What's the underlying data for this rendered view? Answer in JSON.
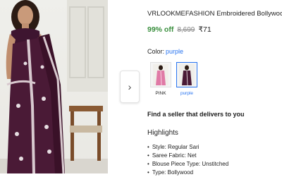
{
  "product": {
    "title": "VRLOOKMEFASHION Embroidered Bollywood",
    "discount": "99% off",
    "mrp": "8,699",
    "price": "₹71"
  },
  "color": {
    "label": "Color:",
    "selected": "purple",
    "options": [
      {
        "name": "PINK"
      },
      {
        "name": "purple"
      }
    ]
  },
  "seller_heading": "Find a seller that delivers to you",
  "highlights": {
    "title": "Highlights",
    "items": [
      "Style: Regular Sari",
      "Saree Fabric: Net",
      "Blouse Piece Type: Unstitched",
      "Type: Bollywood"
    ]
  },
  "icons": {
    "next": "chevron-right-icon"
  },
  "colors": {
    "accent": "#2874f0",
    "discount": "#388e3c",
    "saree_purple": "#4a1a36",
    "saree_pink": "#e07aa6"
  }
}
